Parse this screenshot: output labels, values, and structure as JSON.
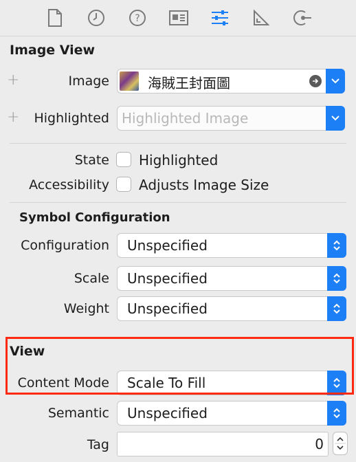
{
  "image_view": {
    "title": "Image View",
    "image_label": "Image",
    "image_value": "海賊王封面圖",
    "highlighted_label": "Highlighted",
    "highlighted_placeholder": "Highlighted Image",
    "state_label": "State",
    "state_option": "Highlighted",
    "state_checked": false,
    "accessibility_label": "Accessibility",
    "accessibility_option": "Adjusts Image Size",
    "accessibility_checked": false
  },
  "symbol_configuration": {
    "title": "Symbol Configuration",
    "configuration_label": "Configuration",
    "configuration_value": "Unspecified",
    "scale_label": "Scale",
    "scale_value": "Unspecified",
    "weight_label": "Weight",
    "weight_value": "Unspecified"
  },
  "view": {
    "title": "View",
    "content_mode_label": "Content Mode",
    "content_mode_value": "Scale To Fill",
    "semantic_label": "Semantic",
    "semantic_value": "Unspecified",
    "tag_label": "Tag",
    "tag_value": "0"
  },
  "toolbar": {
    "icons": [
      "file-inspector-icon",
      "history-inspector-icon",
      "quick-help-icon",
      "identity-inspector-icon",
      "attributes-inspector-icon",
      "size-inspector-icon",
      "connections-inspector-icon"
    ],
    "active_icon": "attributes-inspector-icon"
  },
  "colors": {
    "accent": "#1c7ff5",
    "highlight_box": "#ff2a12",
    "background": "#ececec"
  }
}
